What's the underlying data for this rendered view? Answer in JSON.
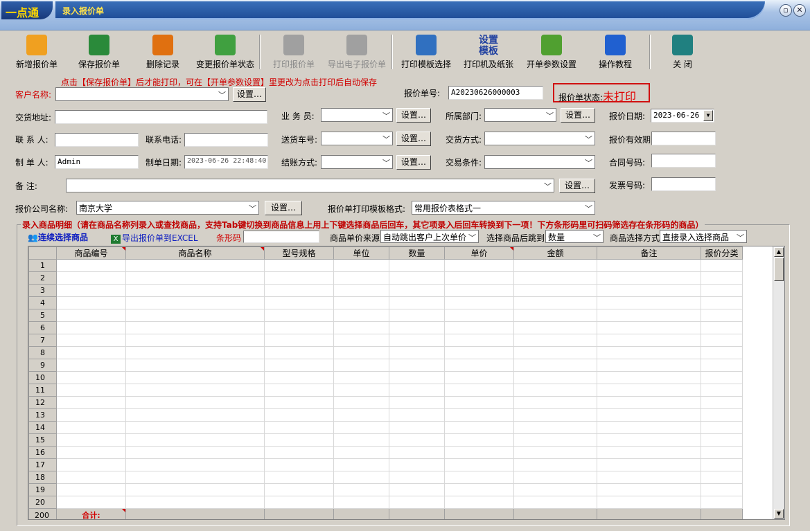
{
  "app": {
    "logo": "一点通",
    "title": "录入报价单"
  },
  "window": {
    "restore_icon": "restore-icon",
    "close_icon": "close-icon"
  },
  "toolbar": [
    {
      "label": "新增报价单",
      "icon": "new-doc-icon",
      "color": "#f0a020",
      "enabled": true
    },
    {
      "label": "保存报价单",
      "icon": "save-icon",
      "color": "#2a8a3a",
      "enabled": true
    },
    {
      "label": "删除记录",
      "icon": "delete-icon",
      "color": "#e07010",
      "enabled": true
    },
    {
      "label": "变更报价单状态",
      "icon": "refresh-icon",
      "color": "#40a040",
      "enabled": true
    },
    {
      "label": "打印报价单",
      "icon": "printer-icon",
      "color": "#a0a0a0",
      "enabled": false
    },
    {
      "label": "导出电子报价单",
      "icon": "export-icon",
      "color": "#a0a0a0",
      "enabled": false
    },
    {
      "label": "打印模板选择",
      "icon": "template-icon",
      "color": "#3070c0",
      "enabled": true
    },
    {
      "label": "打印机及纸张",
      "icon": "",
      "color": "#2040a0",
      "enabled": true,
      "top_text": "设置\n模板"
    },
    {
      "label": "开单参数设置",
      "icon": "list-icon",
      "color": "#50a030",
      "enabled": true
    },
    {
      "label": "操作教程",
      "icon": "help-icon",
      "color": "#2060d0",
      "enabled": true
    },
    {
      "label": "关 闭",
      "icon": "exit-door-icon",
      "color": "#208080",
      "enabled": true
    }
  ],
  "hint": "点击【保存报价单】后才能打印，可在【开单参数设置】里更改为点击打印后自动保存",
  "form": {
    "customer_label": "客户名称:",
    "customer_value": "",
    "set_label": "设置…",
    "quote_no_label": "报价单号:",
    "quote_no": "A20230626000003",
    "status_label": "报价单状态:",
    "status_value": "未打印",
    "address_label": "交货地址:",
    "salesman_label": "业 务 员:",
    "dept_label": "所属部门:",
    "date_label": "报价日期:",
    "date_value": "2023-06-26",
    "contact_label": "联 系 人:",
    "phone_label": "联系电话:",
    "vehicle_label": "送货车号:",
    "delivery_label": "交货方式:",
    "valid_label": "报价有效期",
    "maker_label": "制 单 人:",
    "maker_value": "Admin",
    "make_date_label": "制单日期:",
    "make_date_value": "2023-06-26 22:48:40",
    "settle_label": "结账方式:",
    "trade_label": "交易条件:",
    "contract_label": "合同号码:",
    "remark_label": "备    注:",
    "invoice_label": "发票号码:",
    "company_label": "报价公司名称:",
    "company_value": "南京大学",
    "template_label": "报价单打印模板格式:",
    "template_value": "常用报价表格式一"
  },
  "detail": {
    "title": "录入商品明细（请在商品名称列录入或查找商品，支持Tab键切换到商品信息上用上下键选择商品后回车，其它项录入后回车转换到下一项！下方条形码里可扫码筛选存在条形码的商品）",
    "continuous_select": "连续选择商品",
    "export_excel": "导出报价单到EXCEL",
    "barcode_label": "条形码",
    "price_source_label": "商品单价来源",
    "price_source_value": "自动跳出客户上次单价",
    "jump_label": "选择商品后跳到",
    "jump_value": "数量",
    "select_mode_label": "商品选择方式",
    "select_mode_value": "直接录入选择商品"
  },
  "table": {
    "columns": [
      "商品编号",
      "商品名称",
      "型号规格",
      "单位",
      "数量",
      "单价",
      "金额",
      "备注",
      "报价分类"
    ],
    "rows": [
      "1",
      "2",
      "3",
      "4",
      "5",
      "6",
      "7",
      "8",
      "9",
      "10",
      "11",
      "12",
      "13",
      "14",
      "15",
      "16",
      "17",
      "18",
      "19",
      "20"
    ],
    "total_row_no": "200",
    "total_label": "合计:"
  }
}
